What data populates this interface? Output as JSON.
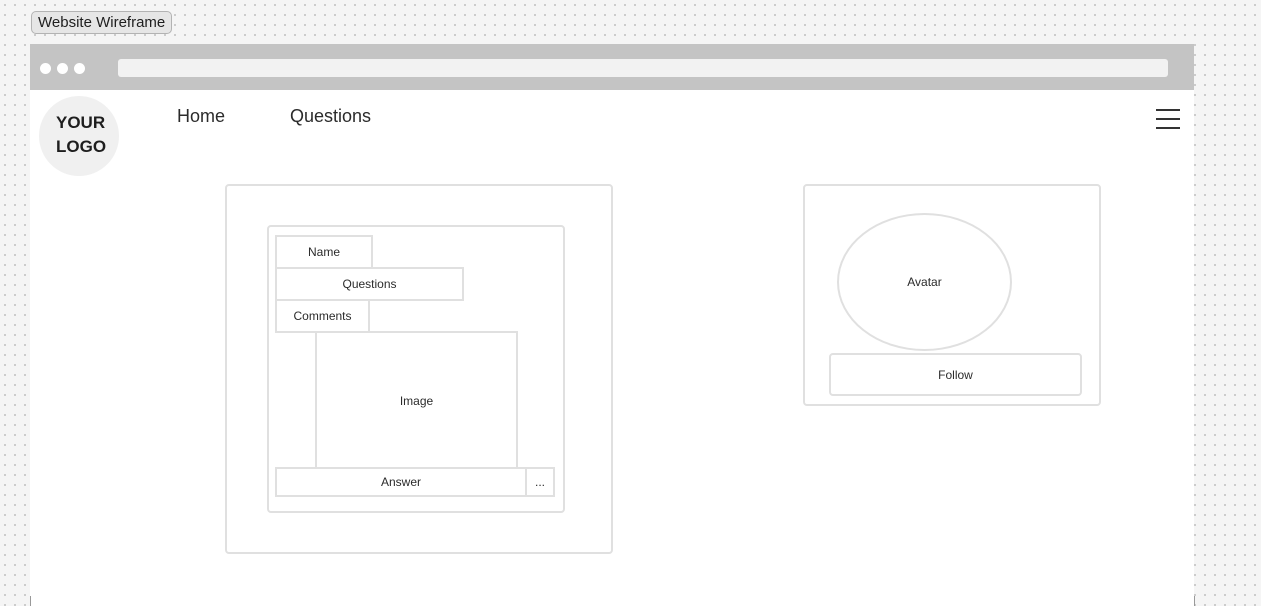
{
  "frame": {
    "title": "Website Wireframe"
  },
  "browser": {
    "address_value": ""
  },
  "header": {
    "logo_text": "YOUR LOGO",
    "nav": [
      {
        "label": "Home"
      },
      {
        "label": "Questions"
      }
    ],
    "menu_icon": "hamburger-menu-icon"
  },
  "question_card": {
    "name_label": "Name",
    "questions_label": "Questions",
    "comments_label": "Comments",
    "image_label": "Image",
    "answer_label": "Answer",
    "more_label": "..."
  },
  "profile_card": {
    "avatar_label": "Avatar",
    "follow_label": "Follow"
  },
  "colors": {
    "canvas": "#f5f5f5",
    "browser_bar": "#c4c4c4",
    "box_border": "#e0e0e0",
    "text": "#1e1e1e"
  }
}
